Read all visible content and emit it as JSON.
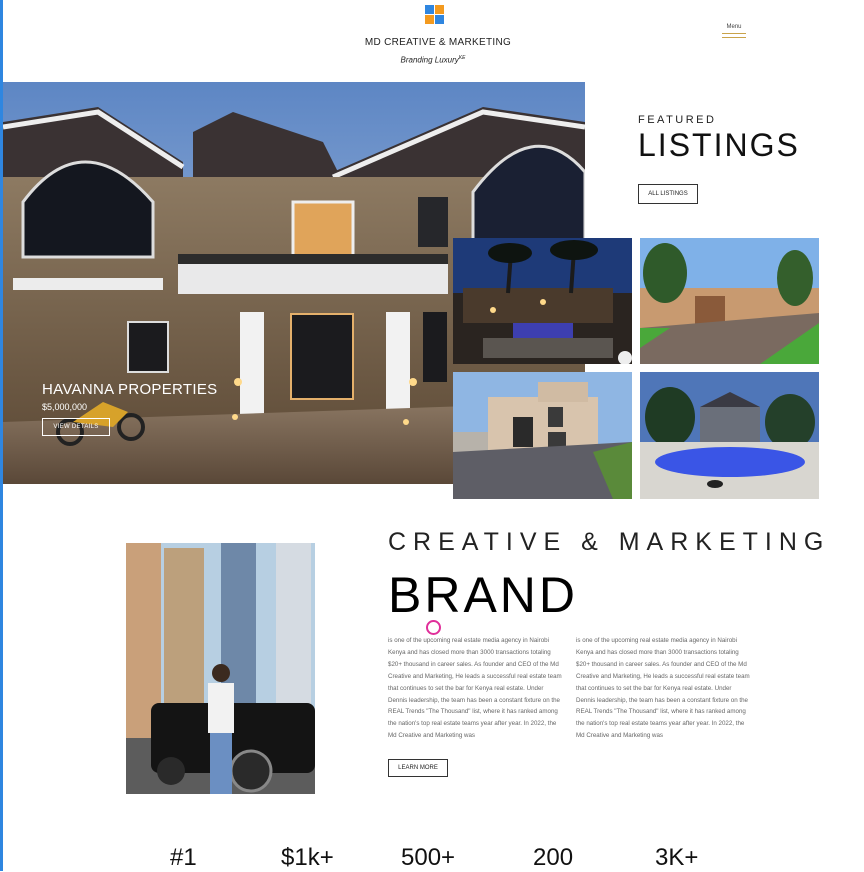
{
  "header": {
    "brand_title": "MD CREATIVE & MARKETING",
    "tagline": "Branding Luxury",
    "tagline_mark": "KE",
    "menu_label": "Menu"
  },
  "colors": {
    "accent_gold": "#c9a34a",
    "logo_blue": "#2f86e0",
    "logo_orange": "#f39a1f",
    "cursor_pink": "#e02f9a"
  },
  "hero": {
    "name": "HAVANNA PROPERTIES",
    "price": "$5,000,000",
    "button": "VIEW DETAILS"
  },
  "featured": {
    "small_heading": "FEATURED",
    "big_heading": "LISTINGS",
    "button": "ALL LISTINGS"
  },
  "about": {
    "heading_top": "CREATIVE & MARKETING",
    "heading_main": "BRAND",
    "paragraph_1": "is one of the upcoming real estate media agency in Nairobi Kenya and has closed more than 3000 transactions totaling $20+ thousand in career sales. As founder and CEO of the Md Creative and Marketing, He leads a successful real estate team that continues to set the bar for Kenya real estate. Under Dennis leadership, the team has been a constant fixture on the REAL Trends \"The Thousand\" list, where it has ranked among the nation's top real estate teams year after year. In 2022, the Md Creative and Marketing was",
    "paragraph_2": "is one of the upcoming real estate media agency in Nairobi Kenya and has closed more than 3000 transactions totaling $20+ thousand in career sales. As founder and CEO of the Md Creative and Marketing, He leads a successful real estate team that continues to set the bar for Kenya real estate. Under Dennis leadership, the team has been a constant fixture on the REAL Trends \"The Thousand\" list, where it has ranked among the nation's top real estate teams year after year. In 2022, the Md Creative and Marketing was",
    "button": "LEARN MORE"
  },
  "stats": [
    "#1",
    "$1k+",
    "500+",
    "200",
    "3K+"
  ]
}
